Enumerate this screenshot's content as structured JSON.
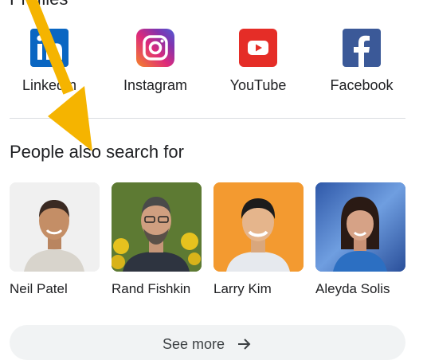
{
  "profiles": {
    "title": "Profiles",
    "items": [
      {
        "label": "LinkedIn",
        "icon": "linkedin-icon",
        "color": "#0a66c2"
      },
      {
        "label": "Instagram",
        "icon": "instagram-icon",
        "color": "#c13584"
      },
      {
        "label": "YouTube",
        "icon": "youtube-icon",
        "color": "#ff0000"
      },
      {
        "label": "Facebook",
        "icon": "facebook-icon",
        "color": "#3b5998"
      }
    ]
  },
  "people": {
    "title": "People also search for",
    "items": [
      {
        "name": "Neil Patel"
      },
      {
        "name": "Rand Fishkin"
      },
      {
        "name": "Larry Kim"
      },
      {
        "name": "Aleyda Solis"
      }
    ]
  },
  "see_more": {
    "label": "See more",
    "icon": "arrow-right-icon"
  },
  "annotation": {
    "icon": "yellow-arrow-icon",
    "color": "#f5b400"
  }
}
